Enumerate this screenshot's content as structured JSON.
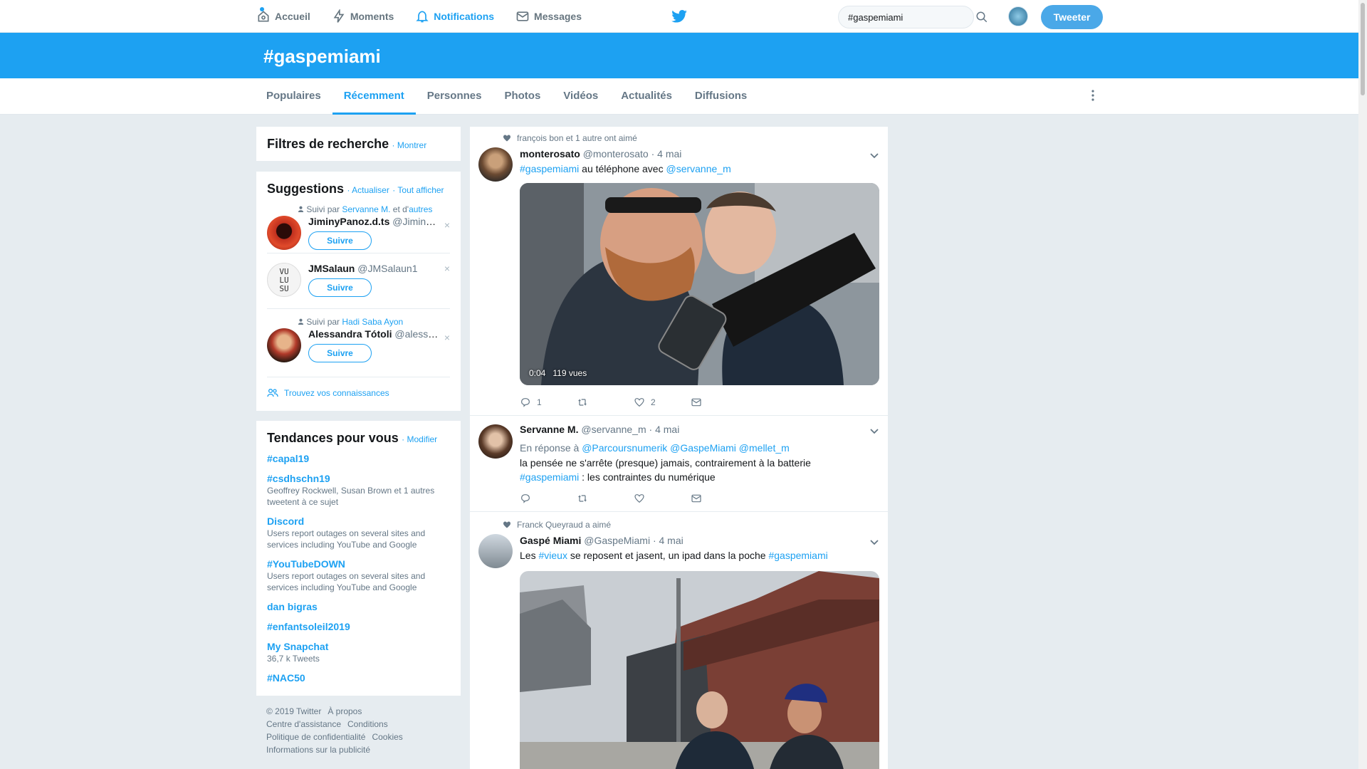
{
  "topnav": {
    "home": "Accueil",
    "moments": "Moments",
    "notifications": "Notifications",
    "messages": "Messages",
    "search_value": "#gaspemiami",
    "tweet_button": "Tweeter"
  },
  "hero": {
    "title": "#gaspemiami"
  },
  "tabs": [
    "Populaires",
    "Récemment",
    "Personnes",
    "Photos",
    "Vidéos",
    "Actualités",
    "Diffusions"
  ],
  "active_tab": "Récemment",
  "filters": {
    "title": "Filtres de recherche",
    "show_link": "· Montrer"
  },
  "suggestions": {
    "title": "Suggestions",
    "refresh": "· Actualiser",
    "view_all": "· Tout afficher",
    "items": [
      {
        "followed_prefix": "Suivi par",
        "followed_by": "Servanne M.",
        "followed_suffix": "et d'",
        "followed_more": "autres",
        "name": "JiminyPanoz.d.ts",
        "handle": "@JiminyPanoz",
        "follow": "Suivre"
      },
      {
        "name": "JMSalaun",
        "handle": "@JMSalaun1",
        "follow": "Suivre",
        "avatar_text": [
          "VU",
          "LU",
          "SU"
        ]
      },
      {
        "followed_prefix": "Suivi par",
        "followed_by": "Hadi Saba Ayon",
        "name": "Alessandra Tótoli",
        "handle": "@alessandratotoli",
        "follow": "Suivre"
      }
    ],
    "find_friends": "Trouvez vos connaissances"
  },
  "trends": {
    "title": "Tendances pour vous",
    "modify": "· Modifier",
    "items": [
      {
        "name": "#capal19",
        "desc": ""
      },
      {
        "name": "#csdhschn19",
        "desc": "Geoffrey Rockwell, Susan Brown et 1 autres tweetent à ce sujet"
      },
      {
        "name": "Discord",
        "desc": "Users report outages on several sites and services including YouTube and Google"
      },
      {
        "name": "#YouTubeDOWN",
        "desc": "Users report outages on several sites and services including YouTube and Google"
      },
      {
        "name": "dan bigras",
        "desc": ""
      },
      {
        "name": "#enfantsoleil2019",
        "desc": ""
      },
      {
        "name": "My Snapchat",
        "desc": "36,7 k Tweets"
      },
      {
        "name": "#NAC50",
        "desc": ""
      }
    ]
  },
  "footer": {
    "copyright": "© 2019 Twitter",
    "about": "À propos",
    "help": "Centre d'assistance",
    "terms": "Conditions",
    "privacy": "Politique de confidentialité",
    "cookies": "Cookies",
    "ads": "Informations sur la publicité"
  },
  "tweets": [
    {
      "context": "françois bon et 1 autre ont aimé",
      "name": "monterosato",
      "handle": "@monterosato",
      "time": "· 4 mai",
      "hashtag": "#gaspemiami",
      "text": " au téléphone avec ",
      "mention": "@servanne_m",
      "video_time": "0:04",
      "video_views": "119 vues",
      "replies": "1",
      "likes": "2"
    },
    {
      "name": "Servanne M.",
      "handle": "@servanne_m",
      "time": "· 4 mai",
      "reply_prefix": "En réponse à",
      "reply_to": "@Parcoursnumerik @GaspeMiami @mellet_m",
      "line1": "la pensée ne s'arrête (presque) jamais, contrairement à la batterie",
      "hashtag": "#gaspemiami",
      "line2": " : les contraintes du numérique"
    },
    {
      "context": "Franck Queyraud a aimé",
      "name": "Gaspé Miami",
      "handle": "@GaspeMiami",
      "time": "· 4 mai",
      "text_a": "Les ",
      "hashtag_a": "#vieux",
      "text_b": " se reposent et jasent, un ipad dans la poche ",
      "hashtag_b": "#gaspemiami"
    }
  ],
  "colors": {
    "accent": "#1da1f2",
    "background": "#e6ecf0",
    "muted": "#657786"
  }
}
